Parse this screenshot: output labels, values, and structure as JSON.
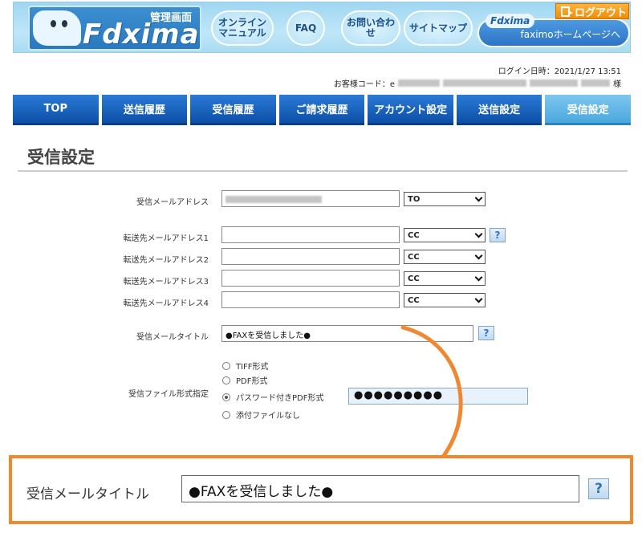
{
  "header": {
    "brand": "Fdxima",
    "admin_label": "管理画面",
    "nav": {
      "online_manual": "オンライン\nマニュアル",
      "faq": "FAQ",
      "contact": "お問い合わせ",
      "sitemap": "サイトマップ"
    },
    "banner_mini": "Fdxima",
    "banner_text": "faximoホームページへ",
    "logout": "ログアウト"
  },
  "info": {
    "login_time": "ログイン日時：2021/1/27 13:51",
    "customer_code_label": "お客様コード：e",
    "honorific": "様"
  },
  "tabs": [
    {
      "label": "TOP",
      "active": false
    },
    {
      "label": "送信履歴",
      "active": false
    },
    {
      "label": "受信履歴",
      "active": false
    },
    {
      "label": "ご請求履歴",
      "active": false
    },
    {
      "label": "アカウント設定",
      "active": false
    },
    {
      "label": "送信設定",
      "active": false
    },
    {
      "label": "受信設定",
      "active": true
    }
  ],
  "page_title": "受信設定",
  "form": {
    "receive_email_label": "受信メールアドレス",
    "receive_email_select": "TO",
    "forward_labels": [
      "転送先メールアドレス1",
      "転送先メールアドレス2",
      "転送先メールアドレス3",
      "転送先メールアドレス4"
    ],
    "forward_selects": [
      "CC",
      "CC",
      "CC",
      "CC"
    ],
    "mail_title_label": "受信メールタイトル",
    "mail_title_value": "●FAXを受信しました●",
    "file_format_label": "受信ファイル形式指定",
    "file_formats": [
      {
        "label": "TIFF形式",
        "selected": false
      },
      {
        "label": "PDF形式",
        "selected": false
      },
      {
        "label": "パスワード付きPDF形式",
        "selected": true
      },
      {
        "label": "添付ファイルなし",
        "selected": false
      }
    ],
    "password_mask": "●●●●●●●●●"
  },
  "zoom": {
    "label": "受信メールタイトル",
    "value": "●FAXを受信しました●"
  },
  "help_glyph": "?",
  "colors": {
    "tab_blue": "#0c4fa6",
    "tab_active": "#4aa7de",
    "highlight_orange": "#f1882f"
  }
}
